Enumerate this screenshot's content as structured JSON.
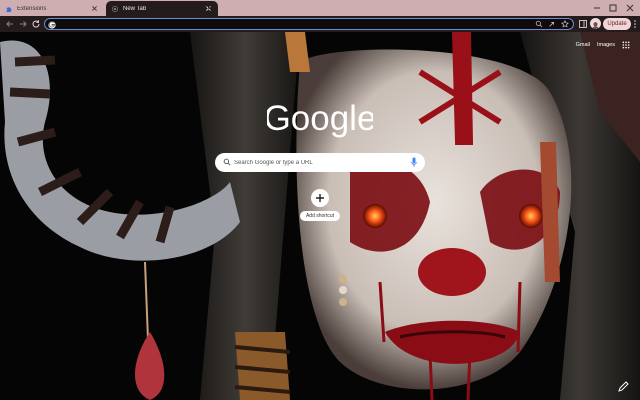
{
  "tabs": [
    {
      "label": "Extensions",
      "state": "inactive",
      "icon": "puzzle-icon"
    },
    {
      "label": "New Tab",
      "state": "active",
      "icon": "chrome-icon"
    }
  ],
  "toolbar": {
    "address_value": "",
    "update_label": "Update",
    "icons": [
      "back-arrow-icon",
      "forward-arrow-icon",
      "reload-icon",
      "zoom-icon",
      "share-icon",
      "star-icon",
      "sidebar-icon",
      "avatar-icon",
      "kebab-menu-icon"
    ]
  },
  "ntp": {
    "top_links": {
      "gmail": "Gmail",
      "images": "Images"
    },
    "search_placeholder": "Search Google or type a URL",
    "shortcut_label": "Add shortcut"
  },
  "colors": {
    "tab_strip": "#cfaeb1",
    "toolbar": "#241b1c",
    "omnibox_border": "#6b8cd8",
    "update_button": "#f3d5d7",
    "search_box": "#ffffff",
    "mic_blue": "#4285f4"
  }
}
